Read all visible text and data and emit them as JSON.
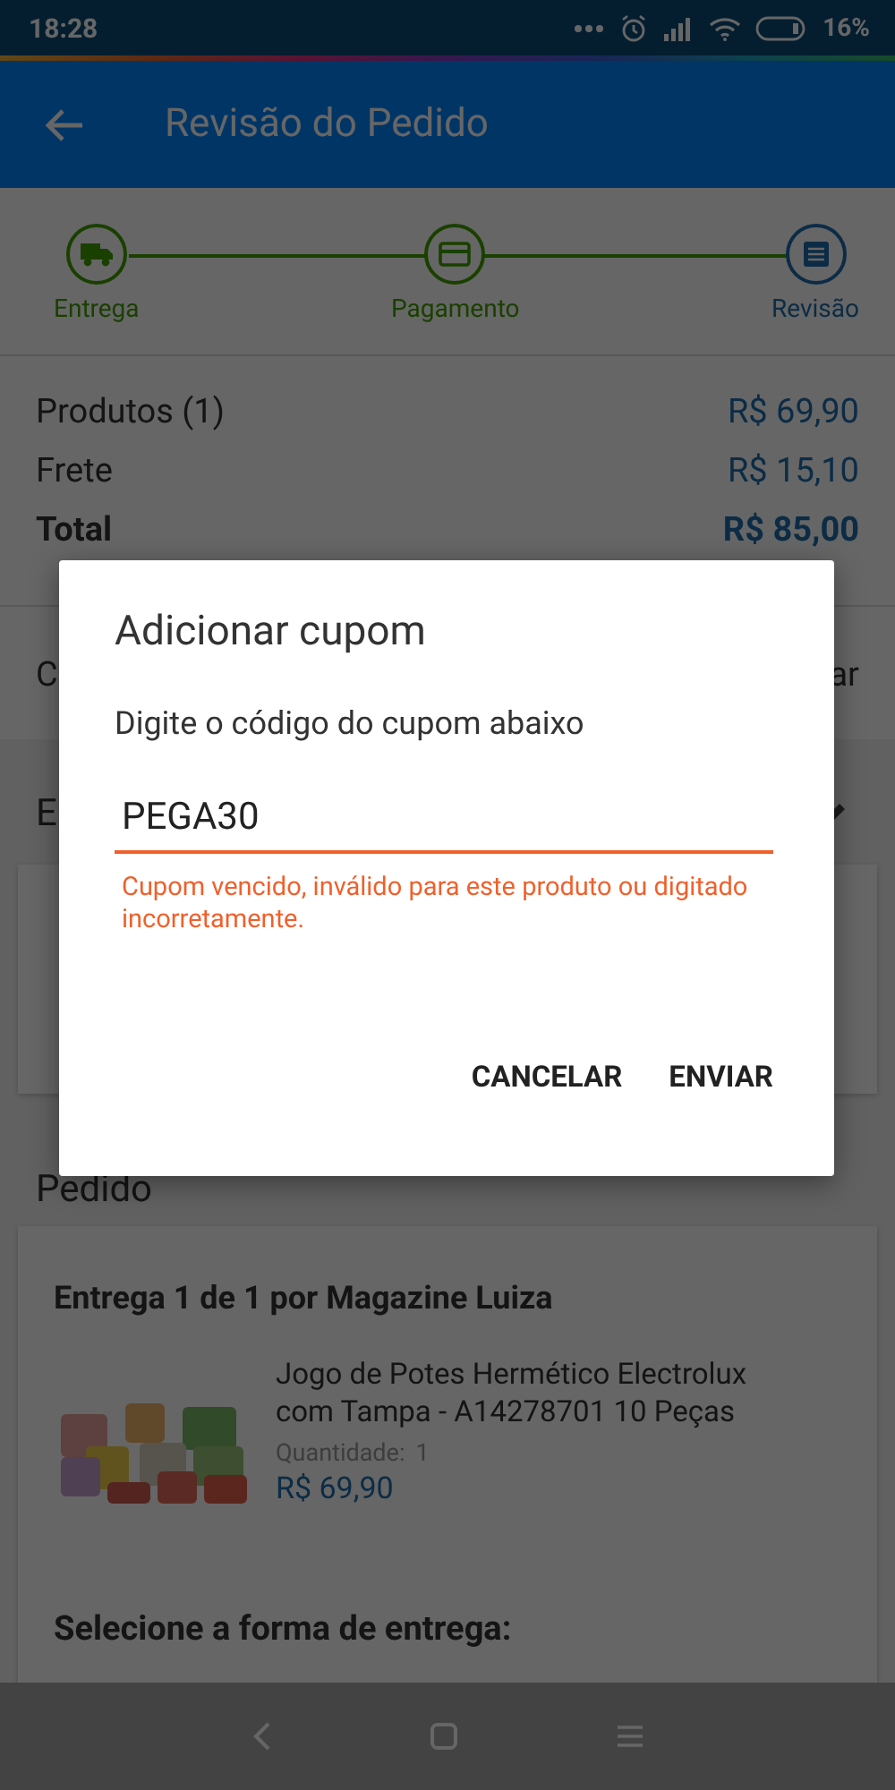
{
  "status_bar": {
    "time": "18:28",
    "battery": "16%"
  },
  "app_bar": {
    "title": "Revisão do Pedido"
  },
  "stepper": {
    "steps": [
      {
        "label": "Entrega",
        "done": true
      },
      {
        "label": "Pagamento",
        "done": true
      },
      {
        "label": "Revisão",
        "done": false
      }
    ]
  },
  "summary": {
    "rows": [
      {
        "label": "Produtos (1)",
        "value": "R$ 69,90",
        "kind": "line"
      },
      {
        "label": "Frete",
        "value": "R$ 15,10",
        "kind": "line"
      },
      {
        "label": "Total",
        "value": "R$ 85,00",
        "kind": "total"
      }
    ]
  },
  "coupon_row": {
    "label": "C",
    "action": "ar"
  },
  "address_section": {
    "title": "E"
  },
  "order_section": {
    "title": "Pedido",
    "delivery_title": "Entrega 1 de 1 por Magazine Luiza",
    "product": {
      "name": "Jogo de Potes Hermético Electrolux com Tampa - A14278701 10 Peças",
      "quantity_label": "Quantidade:",
      "quantity": "1",
      "price": "R$ 69,90"
    },
    "shipping_prompt": "Selecione a forma de entrega:"
  },
  "dialog": {
    "title": "Adicionar cupom",
    "message": "Digite o código do cupom abaixo",
    "input_value": "PEGA30",
    "error": "Cupom vencido, inválido para este produto ou digitado incorretamente.",
    "buttons": [
      "CANCELAR",
      "ENVIAR"
    ]
  }
}
